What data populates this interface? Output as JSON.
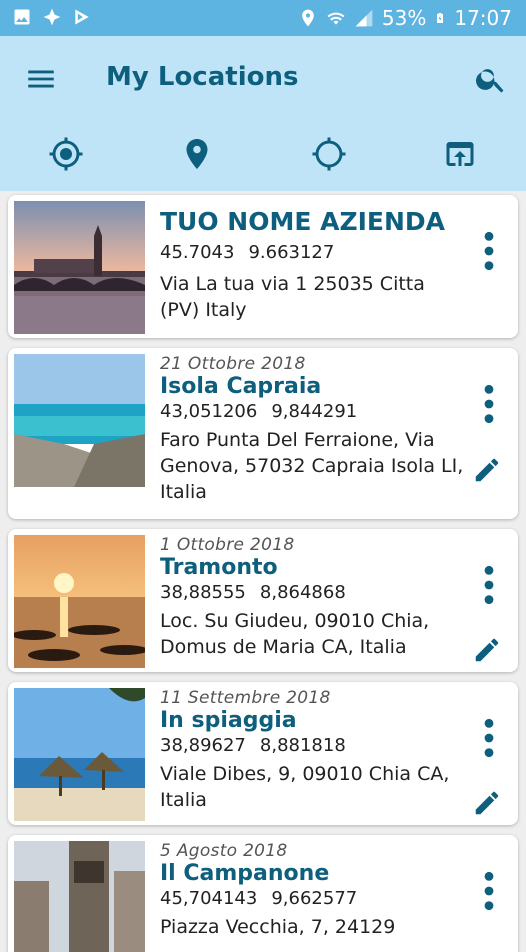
{
  "status_bar": {
    "battery": "53%",
    "time": "17:07"
  },
  "app_bar": {
    "title": "My Locations",
    "menu_icon": "hamburger-menu-icon",
    "search_icon": "search-icon"
  },
  "tabs": [
    {
      "icon": "gps-fixed-icon",
      "selected": false
    },
    {
      "icon": "place-pin-icon",
      "selected": true
    },
    {
      "icon": "gps-not-fixed-icon",
      "selected": false
    },
    {
      "icon": "open-in-browser-icon",
      "selected": false
    }
  ],
  "colors": {
    "status_bar": "#5eb4e0",
    "app_bar": "#bfe4f8",
    "accent": "#0d5f7d",
    "tab_indicator": "#4da9d8"
  },
  "locations": [
    {
      "date": "",
      "name": "TUO NOME AZIENDA",
      "lat": "45.7043",
      "lon": "9.663127",
      "address": "Via La tua via 1 25035 Citta (PV) Italy",
      "editable": false
    },
    {
      "date": "21 Ottobre 2018",
      "name": "Isola Capraia",
      "lat": "43,051206",
      "lon": "9,844291",
      "address": "Faro Punta Del Ferraione, Via Genova, 57032 Capraia Isola LI, Italia",
      "editable": true
    },
    {
      "date": "1 Ottobre 2018",
      "name": "Tramonto",
      "lat": "38,88555",
      "lon": "8,864868",
      "address": "Loc. Su Giudeu, 09010 Chia, Domus de Maria CA, Italia",
      "editable": true
    },
    {
      "date": "11 Settembre 2018",
      "name": "In spiaggia",
      "lat": "38,89627",
      "lon": "8,881818",
      "address": "Viale Dibes, 9, 09010 Chia CA, Italia",
      "editable": true
    },
    {
      "date": "5 Agosto 2018",
      "name": "Il Campanone",
      "lat": "45,704143",
      "lon": "9,662577",
      "address": "Piazza Vecchia, 7, 24129",
      "editable": true
    }
  ]
}
